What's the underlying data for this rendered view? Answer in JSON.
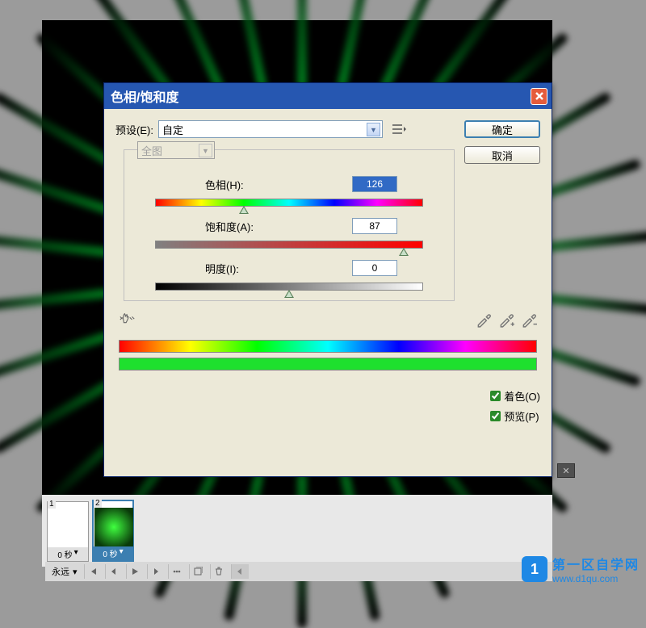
{
  "dialog": {
    "title": "色相/饱和度",
    "preset_label": "预设(E):",
    "preset_value": "自定",
    "channel": "全图",
    "ok": "确定",
    "cancel": "取消",
    "hue_label": "色相(H):",
    "hue_value": "126",
    "sat_label": "饱和度(A):",
    "sat_value": "87",
    "light_label": "明度(I):",
    "light_value": "0",
    "colorize": "着色(O)",
    "preview": "预览(P)"
  },
  "frames": {
    "f1": {
      "num": "1",
      "time": "0 秒"
    },
    "f2": {
      "num": "2",
      "time": "0 秒"
    }
  },
  "controls": {
    "loop": "永远"
  },
  "watermark": {
    "logo": "1",
    "text": "第一区自学网",
    "url": "www.d1qu.com"
  }
}
